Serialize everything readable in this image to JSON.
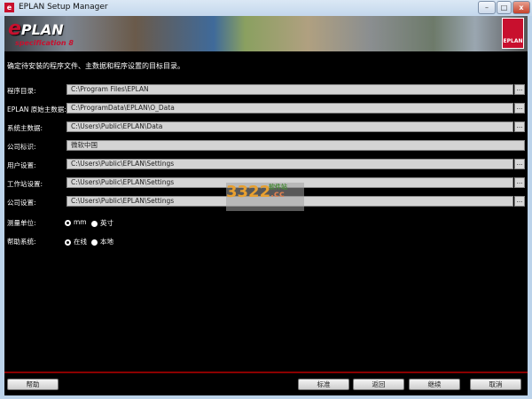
{
  "window": {
    "title": "EPLAN Setup Manager",
    "minimize": "–",
    "maximize": "□",
    "close": "x"
  },
  "banner": {
    "logo": "PLAN",
    "logo_e": "e",
    "logo_sub": "specification 8",
    "badge": "EPLAN"
  },
  "intro": "确定待安装的程序文件、主数据和程序设置的目标目录。",
  "rows": [
    {
      "label": "程序目录:",
      "value": "C:\\Program Files\\EPLAN",
      "browse": "..."
    },
    {
      "label": "EPLAN 原始主数据:",
      "value": "C:\\ProgramData\\EPLAN\\O_Data",
      "browse": "..."
    },
    {
      "label": "系统主数据:",
      "value": "C:\\Users\\Public\\EPLAN\\Data",
      "browse": "..."
    },
    {
      "label": "公司标识:",
      "value": "微软中国"
    },
    {
      "label": "用户设置:",
      "value": "C:\\Users\\Public\\EPLAN\\Settings",
      "browse": "..."
    },
    {
      "label": "工作站设置:",
      "value": "C:\\Users\\Public\\EPLAN\\Settings",
      "browse": "..."
    },
    {
      "label": "公司设置:",
      "value": "C:\\Users\\Public\\EPLAN\\Settings",
      "browse": "..."
    }
  ],
  "units": {
    "label": "测量单位:",
    "options": [
      "mm",
      "英寸"
    ],
    "selected": "mm"
  },
  "help_system": {
    "label": "帮助系统:",
    "options": [
      "在线",
      "本地"
    ],
    "selected": "在线"
  },
  "buttons": {
    "help": "帮助",
    "standard": "标准",
    "back": "返回",
    "next": "继续",
    "cancel": "取消"
  },
  "watermark": {
    "text": "3322",
    "suffix": ".cc",
    "site": "软件站"
  },
  "colors": {
    "accent": "#c8102e",
    "background": "#000000",
    "separator": "#8b0000"
  }
}
